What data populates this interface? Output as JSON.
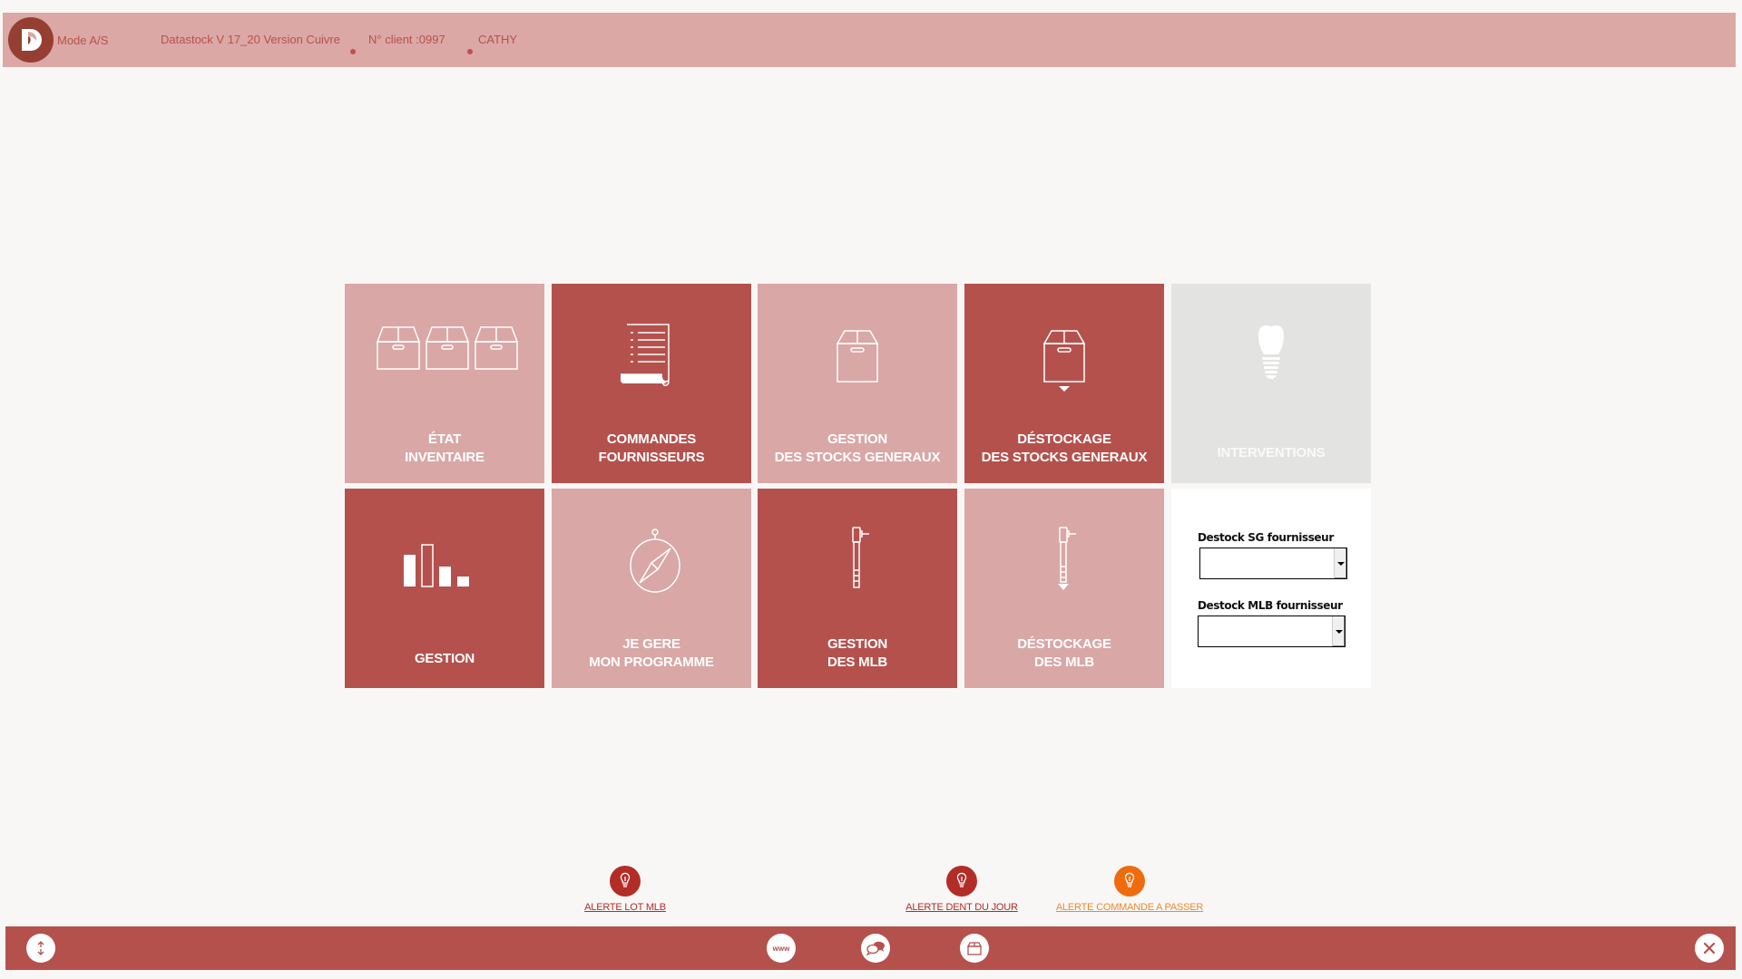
{
  "header": {
    "mode": "Mode A/S",
    "title": "Datastock V 17_20 Version Cuivre",
    "client": "N° client :0997",
    "user": "CATHY",
    "logo_icon": "datastock-d-logo"
  },
  "tiles": [
    {
      "lines": [
        "ÉTAT",
        "INVENTAIRE"
      ],
      "icon": "three-boxes-icon",
      "style": "light"
    },
    {
      "lines": [
        "COMMANDES",
        "FOURNISSEURS"
      ],
      "icon": "document-list-icon",
      "style": "dark"
    },
    {
      "lines": [
        "GESTION",
        "DES STOCKS GENERAUX"
      ],
      "icon": "box-icon",
      "style": "light"
    },
    {
      "lines": [
        "DÉSTOCKAGE",
        "DES STOCKS GENERAUX"
      ],
      "icon": "box-down-icon",
      "style": "dark"
    },
    {
      "lines": [
        "INTERVENTIONS"
      ],
      "icon": "dental-implant-icon",
      "style": "grey"
    },
    {
      "lines": [
        "GESTION"
      ],
      "icon": "bar-chart-icon",
      "style": "dark"
    },
    {
      "lines": [
        "JE GERE",
        "MON PROGRAMME"
      ],
      "icon": "compass-icon",
      "style": "light"
    },
    {
      "lines": [
        "GESTION",
        "DES MLB"
      ],
      "icon": "handpiece-icon",
      "style": "dark"
    },
    {
      "lines": [
        "DÉSTOCKAGE",
        "DES MLB"
      ],
      "icon": "handpiece-down-icon",
      "style": "light"
    }
  ],
  "panel": {
    "sg_label": "Destock SG fournisseur",
    "sg_value": "",
    "mlb_label": "Destock MLB fournisseur",
    "mlb_value": ""
  },
  "alerts": [
    {
      "label": "ALERTE LOT MLB",
      "color": "#b32d27",
      "icon": "lightbulb-icon"
    },
    {
      "label": "ALERTE DENT DU JOUR",
      "color": "#b32d27",
      "icon": "lightbulb-icon"
    },
    {
      "label": "ALERTE COMMANDE A PASSER",
      "color": "#ef6c0d",
      "icon": "lightbulb-icon"
    }
  ],
  "footer": {
    "resize_icon": "up-down-arrows-icon",
    "www_label": "www",
    "chat_icon": "chat-bubbles-icon",
    "box_icon": "box-icon",
    "close_icon": "close-icon"
  },
  "colors": {
    "header_bg": "#dba8a6",
    "tile_light": "#d9a7a5",
    "tile_dark": "#b5514d",
    "tile_grey": "#e3e3e1",
    "footer_bg": "#b5514d",
    "text_accent": "#b7514d"
  }
}
